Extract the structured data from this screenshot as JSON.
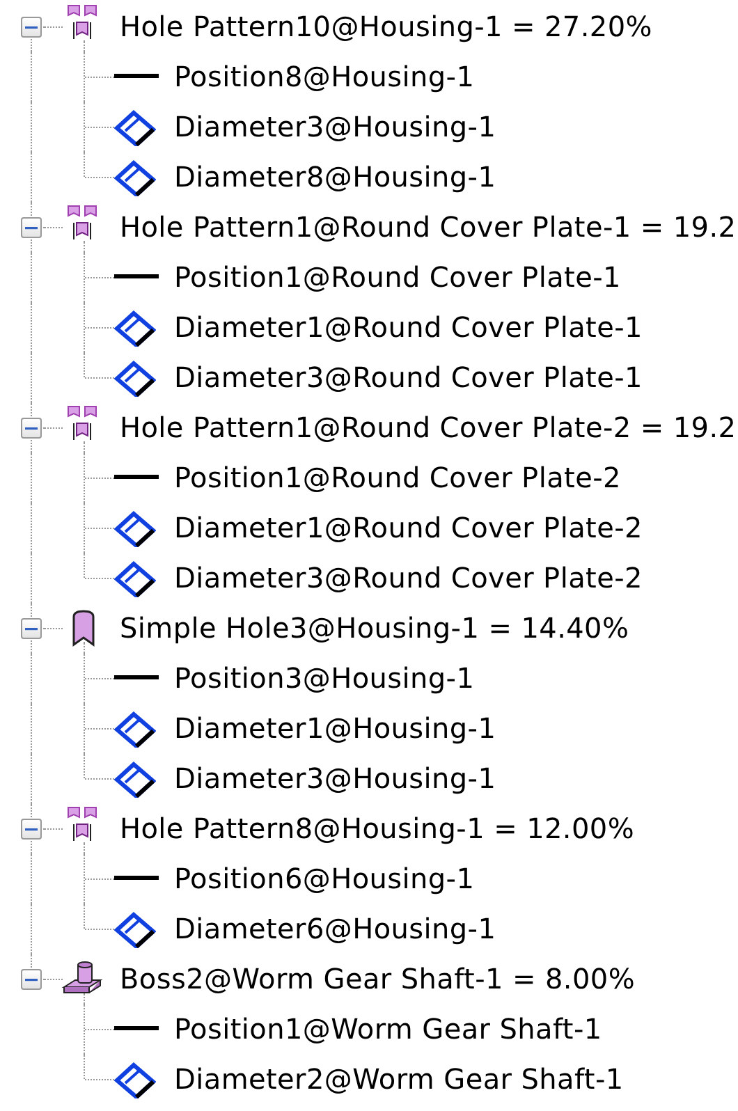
{
  "features": [
    {
      "kind": "pattern",
      "label": "Hole Pattern10@Housing-1 = 27.20%",
      "expanded": true,
      "children": [
        {
          "kind": "position",
          "label": "Position8@Housing-1"
        },
        {
          "kind": "diameter",
          "label": "Diameter3@Housing-1"
        },
        {
          "kind": "diameter",
          "label": "Diameter8@Housing-1"
        }
      ]
    },
    {
      "kind": "pattern",
      "label": "Hole Pattern1@Round Cover Plate-1 = 19.2",
      "expanded": true,
      "children": [
        {
          "kind": "position",
          "label": "Position1@Round Cover Plate-1"
        },
        {
          "kind": "diameter",
          "label": "Diameter1@Round Cover Plate-1"
        },
        {
          "kind": "diameter",
          "label": "Diameter3@Round Cover Plate-1"
        }
      ]
    },
    {
      "kind": "pattern",
      "label": "Hole Pattern1@Round Cover Plate-2 = 19.2",
      "expanded": true,
      "children": [
        {
          "kind": "position",
          "label": "Position1@Round Cover Plate-2"
        },
        {
          "kind": "diameter",
          "label": "Diameter1@Round Cover Plate-2"
        },
        {
          "kind": "diameter",
          "label": "Diameter3@Round Cover Plate-2"
        }
      ]
    },
    {
      "kind": "hole",
      "label": "Simple Hole3@Housing-1 = 14.40%",
      "expanded": true,
      "children": [
        {
          "kind": "position",
          "label": "Position3@Housing-1"
        },
        {
          "kind": "diameter",
          "label": "Diameter1@Housing-1"
        },
        {
          "kind": "diameter",
          "label": "Diameter3@Housing-1"
        }
      ]
    },
    {
      "kind": "pattern",
      "label": "Hole Pattern8@Housing-1 = 12.00%",
      "expanded": true,
      "children": [
        {
          "kind": "position",
          "label": "Position6@Housing-1"
        },
        {
          "kind": "diameter",
          "label": "Diameter6@Housing-1"
        }
      ]
    },
    {
      "kind": "boss",
      "label": "Boss2@Worm Gear Shaft-1 = 8.00%",
      "expanded": true,
      "children": [
        {
          "kind": "position",
          "label": "Position1@Worm Gear Shaft-1"
        },
        {
          "kind": "diameter",
          "label": "Diameter2@Worm Gear Shaft-1"
        }
      ]
    }
  ]
}
